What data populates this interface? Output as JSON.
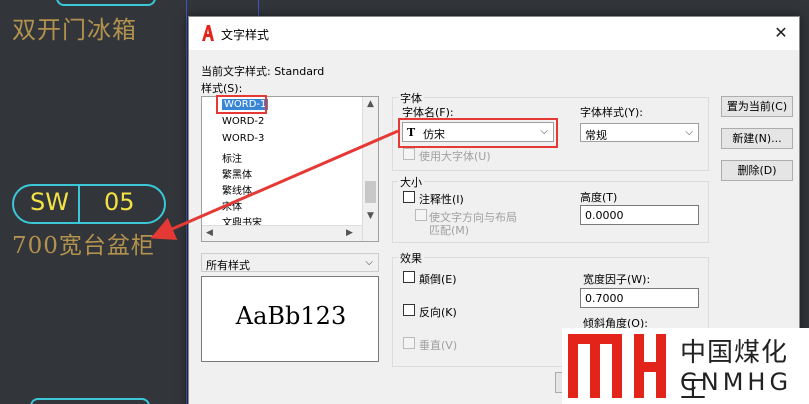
{
  "cad": {
    "text_fridge": "双开门冰箱",
    "tag_left": "SW",
    "tag_right": "05",
    "text_cabinet": "700宽台盆柜"
  },
  "dialog": {
    "title": "文字样式",
    "current_style_label": "当前文字样式: Standard",
    "styles_label": "样式(S):",
    "styles": [
      "WORD-1",
      "WORD-2",
      "WORD-3",
      "标注",
      "繁黑体",
      "繁线体",
      "宋体",
      "文鼎书宋"
    ],
    "selected_style": "WORD-1",
    "filter_value": "所有样式",
    "preview_text": "AaBb123",
    "font_group": {
      "title": "字体",
      "font_name_label": "字体名(F):",
      "font_name_value": "仿宋",
      "font_style_label": "字体样式(Y):",
      "font_style_value": "常规",
      "big_font_label": "使用大字体(U)"
    },
    "size_group": {
      "title": "大小",
      "annotative_label": "注释性(I)",
      "match_orientation_label_1": "使文字方向与布局",
      "match_orientation_label_2": "匹配(M)",
      "height_label": "高度(T)",
      "height_value": "0.0000"
    },
    "effects_group": {
      "title": "效果",
      "upside_down_label": "颠倒(E)",
      "backwards_label": "反向(K)",
      "vertical_label": "垂直(V)",
      "width_factor_label": "宽度因子(W):",
      "width_factor_value": "0.7000",
      "oblique_label": "倾斜角度(O):"
    },
    "buttons": {
      "set_current": "置为当前(C)",
      "new": "新建(N)...",
      "delete": "删除(D)"
    },
    "colors": {
      "highlight": "#e53935",
      "selection": "#3a86d6"
    }
  },
  "watermark": {
    "line1": "中国煤化工",
    "line2": "CNMHG",
    "color": "#e2241b"
  }
}
